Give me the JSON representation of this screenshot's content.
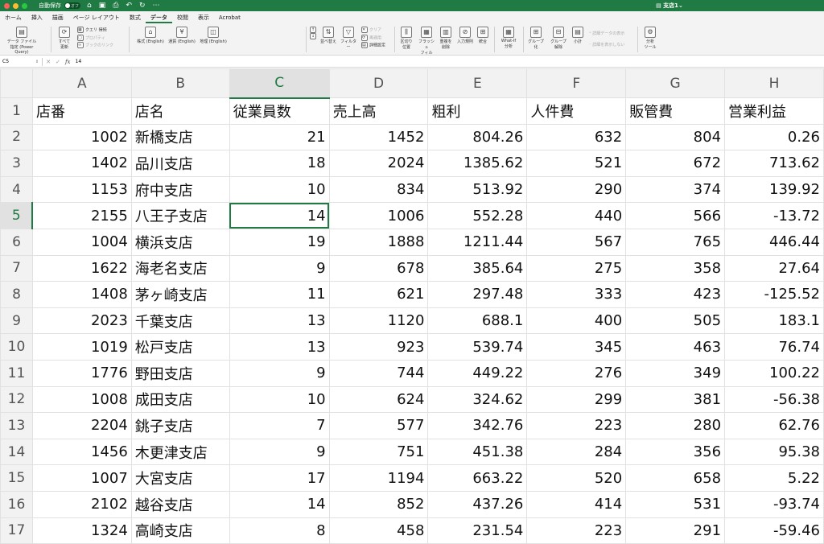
{
  "titlebar": {
    "autosave_label": "自動保存",
    "autosave_state": "オフ",
    "doc_title": "支店1"
  },
  "tabs": [
    "ホーム",
    "挿入",
    "描画",
    "ページ レイアウト",
    "数式",
    "データ",
    "校閲",
    "表示",
    "Acrobat"
  ],
  "active_tab": "データ",
  "ribbon": {
    "get_data": "データ ファイル",
    "get_data2": "指定 (Power Query)",
    "refresh_all": "すべて",
    "refresh_all2": "更新",
    "queries": "クエリ",
    "connections": "接続",
    "properties": "プロパティ",
    "edit_links": "ブックのリンク",
    "stocks": "株式 (English)",
    "currencies": "通貨 (English)",
    "geography": "地理 (English)",
    "sort": "並べ替え",
    "filter": "フィルター",
    "clear": "クリア",
    "reapply": "再適用",
    "advanced": "詳細設定",
    "text_to_columns": "区切り",
    "text_to_columns2": "位置",
    "flash_fill": "フラッシュ",
    "flash_fill2": "フィル",
    "remove_dup": "重複を",
    "remove_dup2": "削除",
    "validation": "入力規則",
    "consolidate": "統合",
    "what_if": "What-If",
    "what_if2": "分析",
    "group": "グループ",
    "group2": "化",
    "ungroup": "グループ",
    "ungroup2": "解除",
    "subtotal": "小計",
    "show_detail": "詳細データの表示",
    "hide_detail": "詳細を表示しない",
    "analysis": "分析",
    "analysis2": "ツール"
  },
  "formula_bar": {
    "name_box": "C5",
    "fx": "fx",
    "value": "14"
  },
  "columns": [
    "A",
    "B",
    "C",
    "D",
    "E",
    "F",
    "G",
    "H"
  ],
  "selected_col": "C",
  "selected_row": 5,
  "rows": [
    {
      "n": "1",
      "cells": [
        "店番",
        "店名",
        "従業員数",
        "売上高",
        "粗利",
        "人件費",
        "販管費",
        "営業利益"
      ]
    },
    {
      "n": "2",
      "cells": [
        "1002",
        "新橋支店",
        "21",
        "1452",
        "804.26",
        "632",
        "804",
        "0.26"
      ]
    },
    {
      "n": "3",
      "cells": [
        "1402",
        "品川支店",
        "18",
        "2024",
        "1385.62",
        "521",
        "672",
        "713.62"
      ]
    },
    {
      "n": "4",
      "cells": [
        "1153",
        "府中支店",
        "10",
        "834",
        "513.92",
        "290",
        "374",
        "139.92"
      ]
    },
    {
      "n": "5",
      "cells": [
        "2155",
        "八王子支店",
        "14",
        "1006",
        "552.28",
        "440",
        "566",
        "-13.72"
      ]
    },
    {
      "n": "6",
      "cells": [
        "1004",
        "横浜支店",
        "19",
        "1888",
        "1211.44",
        "567",
        "765",
        "446.44"
      ]
    },
    {
      "n": "7",
      "cells": [
        "1622",
        "海老名支店",
        "9",
        "678",
        "385.64",
        "275",
        "358",
        "27.64"
      ]
    },
    {
      "n": "8",
      "cells": [
        "1408",
        "茅ヶ崎支店",
        "11",
        "621",
        "297.48",
        "333",
        "423",
        "-125.52"
      ]
    },
    {
      "n": "9",
      "cells": [
        "2023",
        "千葉支店",
        "13",
        "1120",
        "688.1",
        "400",
        "505",
        "183.1"
      ]
    },
    {
      "n": "10",
      "cells": [
        "1019",
        "松戸支店",
        "13",
        "923",
        "539.74",
        "345",
        "463",
        "76.74"
      ]
    },
    {
      "n": "11",
      "cells": [
        "1776",
        "野田支店",
        "9",
        "744",
        "449.22",
        "276",
        "349",
        "100.22"
      ]
    },
    {
      "n": "12",
      "cells": [
        "1008",
        "成田支店",
        "10",
        "624",
        "324.62",
        "299",
        "381",
        "-56.38"
      ]
    },
    {
      "n": "13",
      "cells": [
        "2204",
        "銚子支店",
        "7",
        "577",
        "342.76",
        "223",
        "280",
        "62.76"
      ]
    },
    {
      "n": "14",
      "cells": [
        "1456",
        "木更津支店",
        "9",
        "751",
        "451.38",
        "284",
        "356",
        "95.38"
      ]
    },
    {
      "n": "15",
      "cells": [
        "1007",
        "大宮支店",
        "17",
        "1194",
        "663.22",
        "520",
        "658",
        "5.22"
      ]
    },
    {
      "n": "16",
      "cells": [
        "2102",
        "越谷支店",
        "14",
        "852",
        "437.26",
        "414",
        "531",
        "-93.74"
      ]
    },
    {
      "n": "17",
      "cells": [
        "1324",
        "高崎支店",
        "8",
        "458",
        "231.54",
        "223",
        "291",
        "-59.46"
      ]
    }
  ]
}
